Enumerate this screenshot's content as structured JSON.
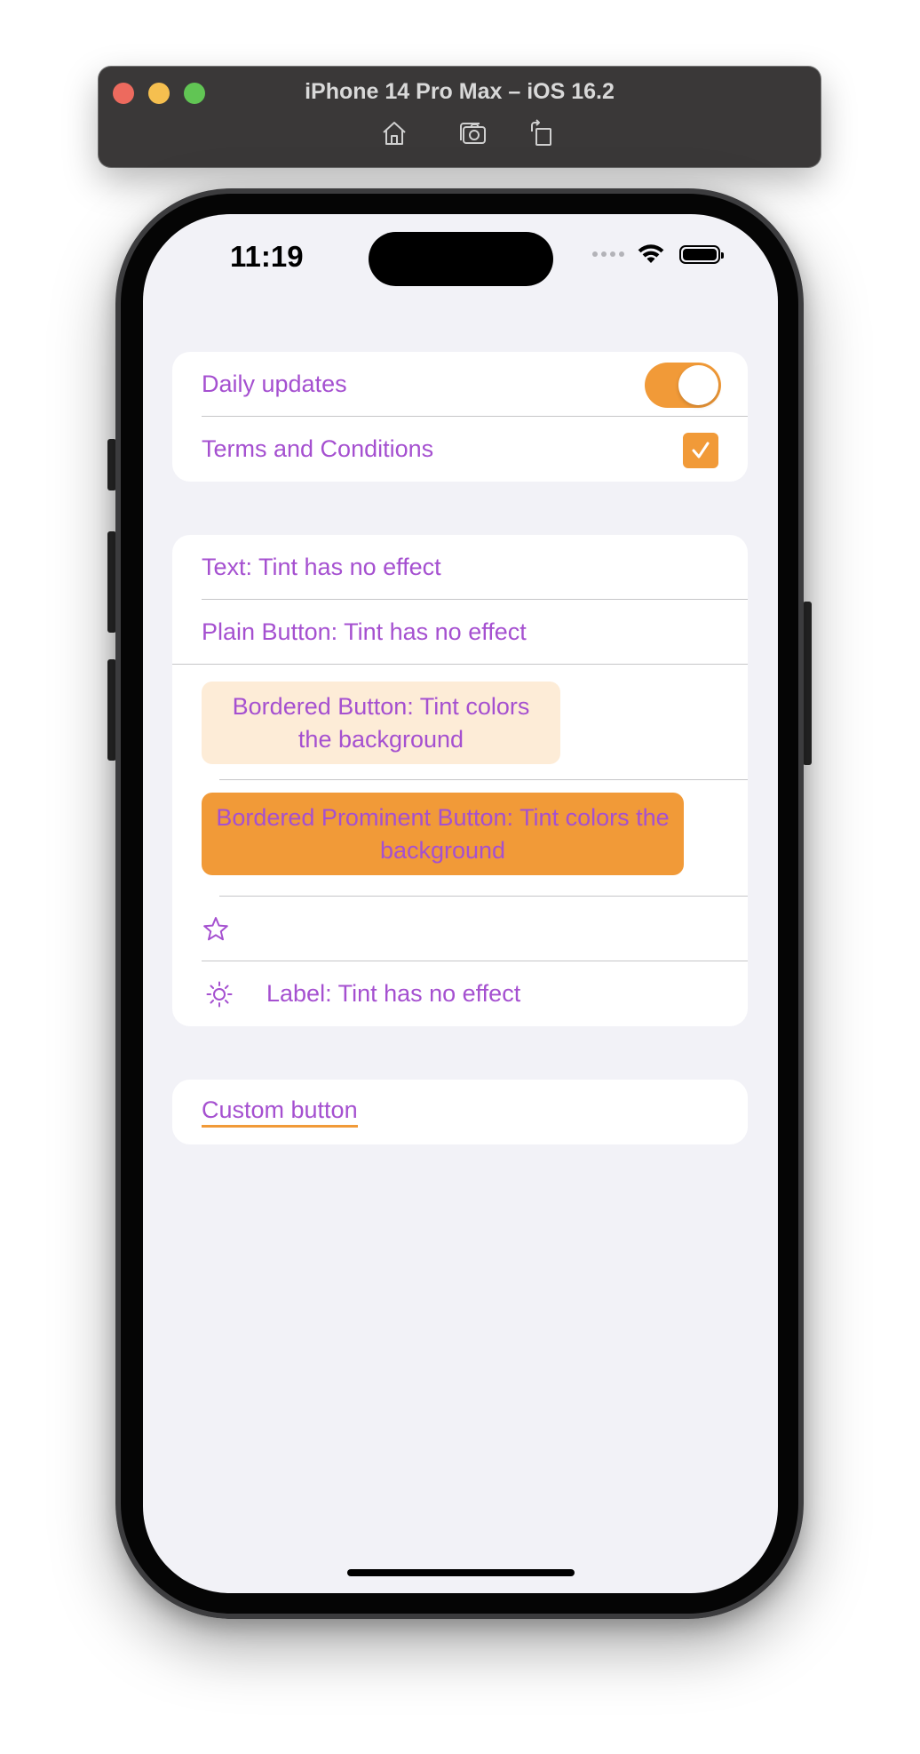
{
  "window": {
    "title": "iPhone 14 Pro Max – iOS 16.2",
    "toolbar_icons": [
      "home-icon",
      "screenshot-icon",
      "rotate-icon"
    ]
  },
  "status_bar": {
    "time": "11:19",
    "icons": [
      "cellular-dots-icon",
      "wifi-icon",
      "battery-icon"
    ]
  },
  "section1": {
    "daily_updates_label": "Daily updates",
    "daily_updates_on": true,
    "terms_label": "Terms and Conditions",
    "terms_checked": true
  },
  "section2": {
    "text_row": "Text: Tint has no effect",
    "plain_button": "Plain Button: Tint has no effect",
    "bordered_button": "Bordered Button: Tint colors the background",
    "bordered_prominent_button": "Bordered Prominent Button: Tint colors the background",
    "star_icon": "star-icon",
    "label_row": "Label: Tint has no effect",
    "label_icon": "sun-icon"
  },
  "section3": {
    "custom_button": "Custom button"
  },
  "colors": {
    "tint_text": "#a550d0",
    "accent": "#f19a38",
    "bordered_bg": "#fdecd7",
    "screen_bg": "#f2f2f7"
  }
}
